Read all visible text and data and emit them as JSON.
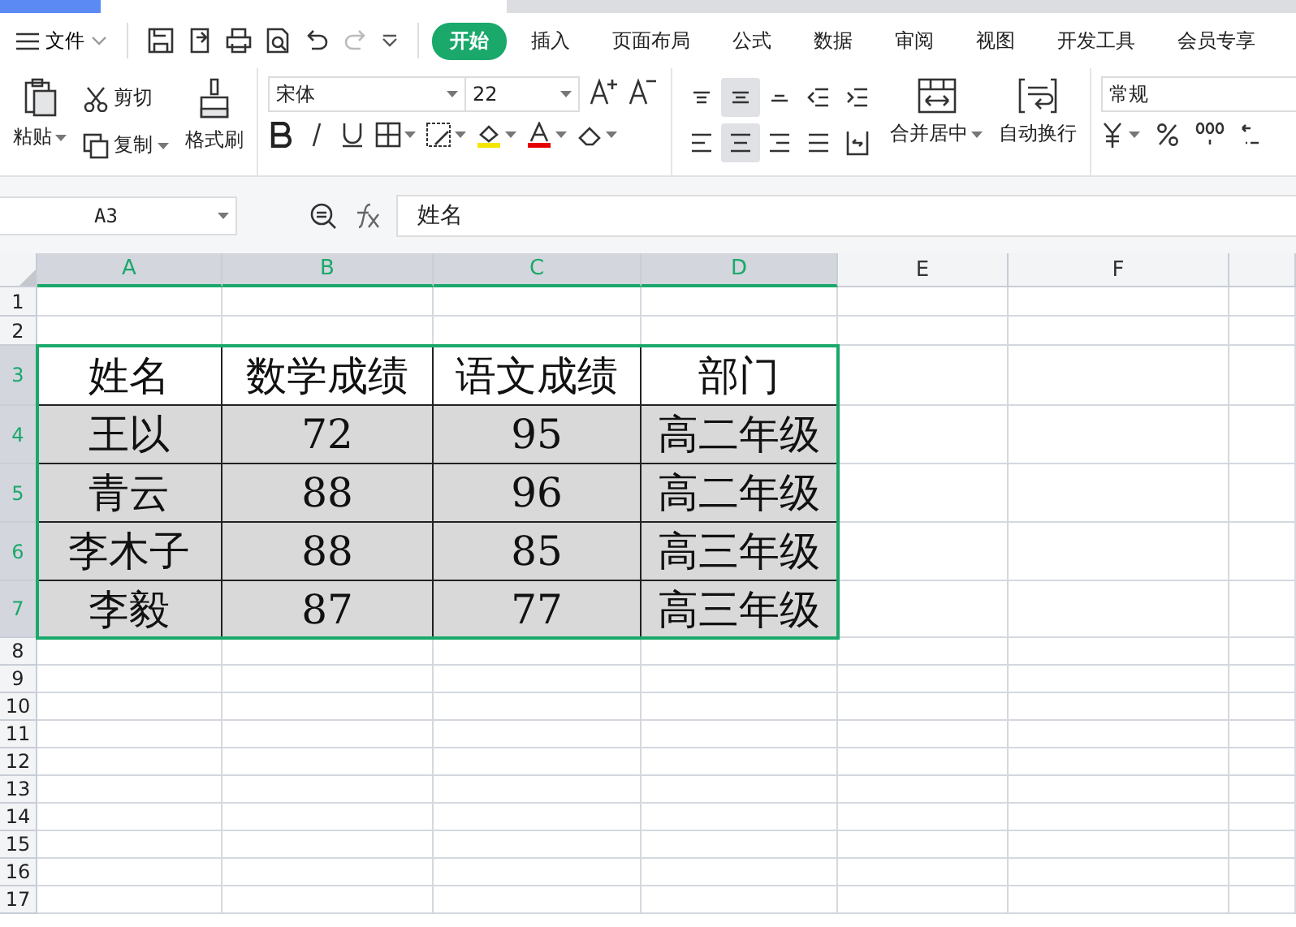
{
  "menu_bar": {
    "file_menu": "文件",
    "tabs": [
      {
        "label": "开始",
        "selected": true
      },
      {
        "label": "插入",
        "selected": false
      },
      {
        "label": "页面布局",
        "selected": false
      },
      {
        "label": "公式",
        "selected": false
      },
      {
        "label": "数据",
        "selected": false
      },
      {
        "label": "审阅",
        "selected": false
      },
      {
        "label": "视图",
        "selected": false
      },
      {
        "label": "开发工具",
        "selected": false
      },
      {
        "label": "会员专享",
        "selected": false
      }
    ]
  },
  "ribbon": {
    "paste": "粘贴",
    "cut": "剪切",
    "copy": "复制",
    "format_painter": "格式刷",
    "font_name": "宋体",
    "font_size": "22",
    "merge_center": "合并居中",
    "wrap_text": "自动换行",
    "number_format": "常规",
    "align_buttons": [
      {
        "selected": false
      },
      {
        "selected": true
      },
      {
        "selected": false
      },
      {
        "selected": false
      },
      {
        "selected": false
      },
      {
        "selected": false
      },
      {
        "selected": true
      },
      {
        "selected": false
      },
      {
        "selected": false
      },
      {
        "selected": false
      }
    ]
  },
  "formula_bar": {
    "name_box": "A3",
    "formula": "姓名"
  },
  "sheet": {
    "columns": [
      {
        "label": "A",
        "selected": true
      },
      {
        "label": "B",
        "selected": true
      },
      {
        "label": "C",
        "selected": true
      },
      {
        "label": "D",
        "selected": true
      },
      {
        "label": "E",
        "selected": false
      },
      {
        "label": "F",
        "selected": false
      }
    ],
    "rows": [
      {
        "label": "1",
        "selected": false
      },
      {
        "label": "2",
        "selected": false
      },
      {
        "label": "3",
        "selected": true,
        "filled": false,
        "cells": [
          "姓名",
          "数学成绩",
          "语文成绩",
          "部门"
        ]
      },
      {
        "label": "4",
        "selected": true,
        "filled": true,
        "cells": [
          "王以",
          "72",
          "95",
          "高二年级"
        ]
      },
      {
        "label": "5",
        "selected": true,
        "filled": true,
        "cells": [
          "青云",
          "88",
          "96",
          "高二年级"
        ]
      },
      {
        "label": "6",
        "selected": true,
        "filled": true,
        "cells": [
          "李木子",
          "88",
          "85",
          "高三年级"
        ]
      },
      {
        "label": "7",
        "selected": true,
        "filled": true,
        "cells": [
          "李毅",
          "87",
          "77",
          "高三年级"
        ]
      },
      {
        "label": "8",
        "selected": false
      },
      {
        "label": "9",
        "selected": false
      },
      {
        "label": "10",
        "selected": false
      },
      {
        "label": "11",
        "selected": false
      },
      {
        "label": "12",
        "selected": false
      },
      {
        "label": "13",
        "selected": false
      },
      {
        "label": "14",
        "selected": false
      },
      {
        "label": "15",
        "selected": false
      },
      {
        "label": "16",
        "selected": false
      },
      {
        "label": "17",
        "selected": false
      }
    ]
  }
}
